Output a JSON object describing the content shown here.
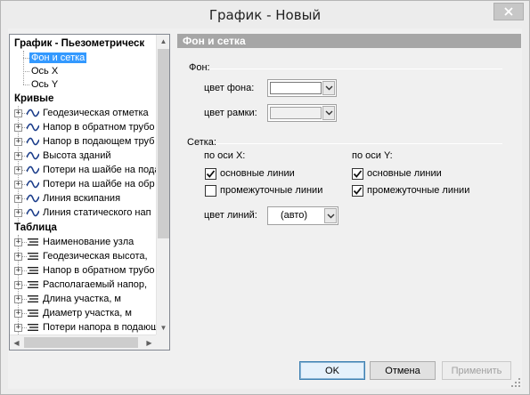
{
  "window": {
    "title": "График - Новый"
  },
  "tree": {
    "header_chart": "График - Пьезометрическ",
    "chart_children": [
      "Фон и сетка",
      "Ось X",
      "Ось Y"
    ],
    "selected": "Фон и сетка",
    "header_curves": "Кривые",
    "curves": [
      "Геодезическая отметка",
      "Напор в обратном трубо",
      "Напор в подающем труб",
      "Высота зданий",
      "Потери на шайбе на пода",
      "Потери на шайбе на обр",
      "Линия вскипания",
      "Линия статического нап"
    ],
    "header_table": "Таблица",
    "table_items": [
      "Наименование узла",
      "Геодезическая высота,",
      "Напор в обратном трубо",
      "Располагаемый напор,",
      "Длина участка, м",
      "Диаметр участка, м",
      "Потери напора в подающ"
    ]
  },
  "panel": {
    "banner": "Фон и сетка",
    "background_group": "Фон:",
    "bg_color_label": "цвет фона:",
    "frame_color_label": "цвет рамки:",
    "grid_group": "Сетка:",
    "x_axis_label": "по оси X:",
    "y_axis_label": "по оси Y:",
    "x_main_lines": {
      "label": "основные линии",
      "checked": true
    },
    "x_minor_lines": {
      "label": "промежуточные линии",
      "checked": false
    },
    "y_main_lines": {
      "label": "основные линии",
      "checked": true
    },
    "y_minor_lines": {
      "label": "промежуточные линии",
      "checked": true
    },
    "line_color_label": "цвет линий:",
    "line_color_value": "(авто)"
  },
  "buttons": {
    "ok": "OK",
    "cancel": "Отмена",
    "apply": "Применить"
  },
  "colors": {
    "selection": "#3399ff",
    "banner": "#a6a6a6",
    "curve_icon": "#1a3c8a"
  }
}
